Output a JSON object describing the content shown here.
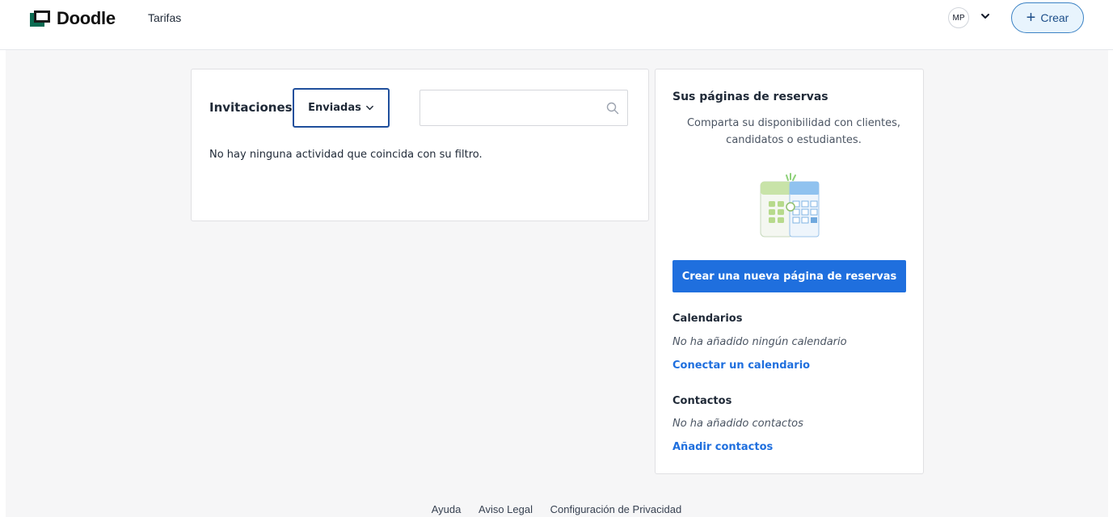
{
  "header": {
    "logo_text": "Doodle",
    "nav_pricing": "Tarifas",
    "avatar_initials": "MP",
    "create_label": "Crear"
  },
  "invites": {
    "title": "Invitaciones",
    "filter_selected": "Enviadas",
    "search_placeholder": "",
    "empty_message": "No hay ninguna actividad que coincida con su filtro."
  },
  "booking": {
    "title": "Sus páginas de reservas",
    "description": "Comparta su disponibilidad con clientes, candidatos o estudiantes.",
    "create_button": "Crear una nueva página de reservas",
    "calendars": {
      "heading": "Calendarios",
      "note": "No ha añadido ningún calendario",
      "link": "Conectar un calendario"
    },
    "contacts": {
      "heading": "Contactos",
      "note": "No ha añadido contactos",
      "link": "Añadir contactos"
    }
  },
  "footer": {
    "links": [
      "Ayuda",
      "Aviso Legal",
      "Configuración de Privacidad"
    ]
  },
  "colors": {
    "primary": "#1f6fde",
    "brand_green": "#0b6b52",
    "filter_border": "#1f4f9c",
    "create_bg": "#e8f4fd"
  }
}
